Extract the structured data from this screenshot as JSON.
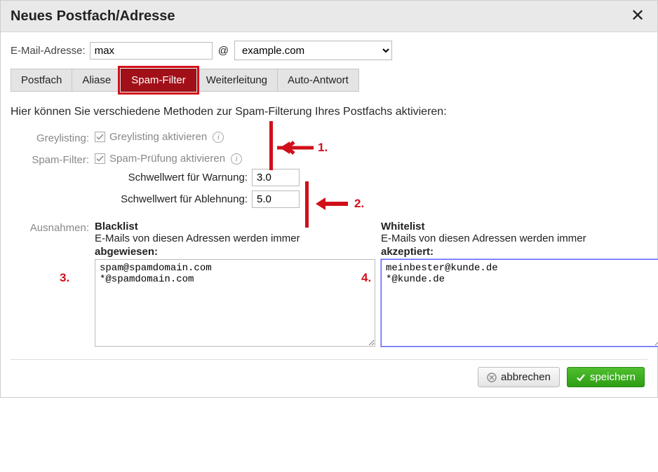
{
  "dialog": {
    "title": "Neues Postfach/Adresse"
  },
  "email": {
    "label": "E-Mail-Adresse:",
    "local": "max",
    "at": "@",
    "domain": "example.com"
  },
  "tabs": {
    "postfach": "Postfach",
    "aliase": "Aliase",
    "spamfilter": "Spam-Filter",
    "weiterleitung": "Weiterleitung",
    "autoantwort": "Auto-Antwort"
  },
  "description": "Hier können Sie verschiedene Methoden zur Spam-Filterung Ihres Postfachs aktivieren:",
  "greylisting": {
    "label": "Greylisting:",
    "checkbox": "Greylisting aktivieren"
  },
  "spamfilter": {
    "label": "Spam-Filter:",
    "checkbox": "Spam-Prüfung aktivieren",
    "warn_label": "Schwellwert für Warnung:",
    "warn_value": "3.0",
    "reject_label": "Schwellwert für Ablehnung:",
    "reject_value": "5.0"
  },
  "exceptions": {
    "label": "Ausnahmen:",
    "blacklist": {
      "title": "Blacklist",
      "sub1": "E-Mails von diesen Adressen werden immer",
      "sub2": "abgewiesen:",
      "value": "spam@spamdomain.com\n*@spamdomain.com"
    },
    "whitelist": {
      "title": "Whitelist",
      "sub1": "E-Mails von diesen Adressen werden immer",
      "sub2": "akzeptiert:",
      "value": "meinbester@kunde.de\n*@kunde.de"
    }
  },
  "annotations": {
    "n1": "1.",
    "n2": "2.",
    "n3": "3.",
    "n4": "4."
  },
  "footer": {
    "cancel": "abbrechen",
    "save": "speichern"
  }
}
